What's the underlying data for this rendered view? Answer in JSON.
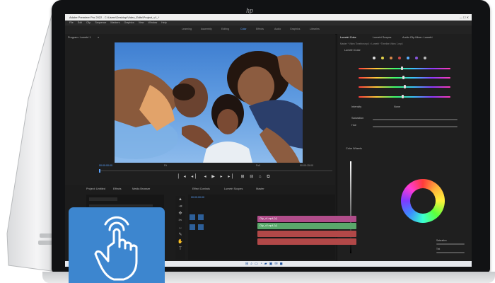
{
  "window": {
    "title": "Adobe Premiere Pro 2022 - C:\\Users\\Desktop\\Video_Edits\\Project_v1_*"
  },
  "menu": [
    "File",
    "Edit",
    "Clip",
    "Sequence",
    "Markers",
    "Graphics",
    "View",
    "Window",
    "Help"
  ],
  "workspaces": [
    "Learning",
    "Assembly",
    "Editing",
    "Color",
    "Effects",
    "Audio",
    "Graphics",
    "Libraries"
  ],
  "active_workspace": "Color",
  "program": {
    "header": "Program: Lumetri 1",
    "timecode_left": "00:00:00:00",
    "fit": "Fit",
    "quality": "Full",
    "timecode_right": "00:00:15:00"
  },
  "lumetri": {
    "tabs": [
      "Lumetri Color",
      "Lumetri Scopes",
      "Audio Clip Mixer: Lumetri"
    ],
    "clip_path": "Master * Video Timeline.mp4 > Lumetri * Timeline Video 1.mp4",
    "section": "Lumetri Color",
    "labels": [
      "Intensity",
      "Saturation",
      "Hue"
    ],
    "input_lut": "None",
    "color_wheels_label": "Color Wheels",
    "section_labels": [
      "Saturation",
      "Tint"
    ]
  },
  "timeline": {
    "tabs": [
      "Project: Untitled",
      "Effects",
      "Media Browser",
      "Effect Controls",
      "Lumetri Scopes",
      "Master"
    ],
    "timecode": "00:00:00:00",
    "clips": [
      {
        "label": "Clip_v1.mp4 [V]",
        "color": "#b04d8a"
      },
      {
        "label": "Clip_v2.mp4 [V]",
        "color": "#5aa86b"
      },
      {
        "label": "",
        "color": "#b24848"
      },
      {
        "label": "",
        "color": "#b24848"
      }
    ]
  },
  "brand": {
    "logo_text": "hp"
  },
  "taskbar_icons": [
    "start-icon",
    "search-icon",
    "taskview-icon",
    "edge-icon",
    "explorer-icon",
    "store-icon",
    "mail-icon",
    "premiere-icon"
  ],
  "colors": {
    "accent": "#5aa3ff",
    "badge": "#3d86cf",
    "bezel": "#111214"
  }
}
